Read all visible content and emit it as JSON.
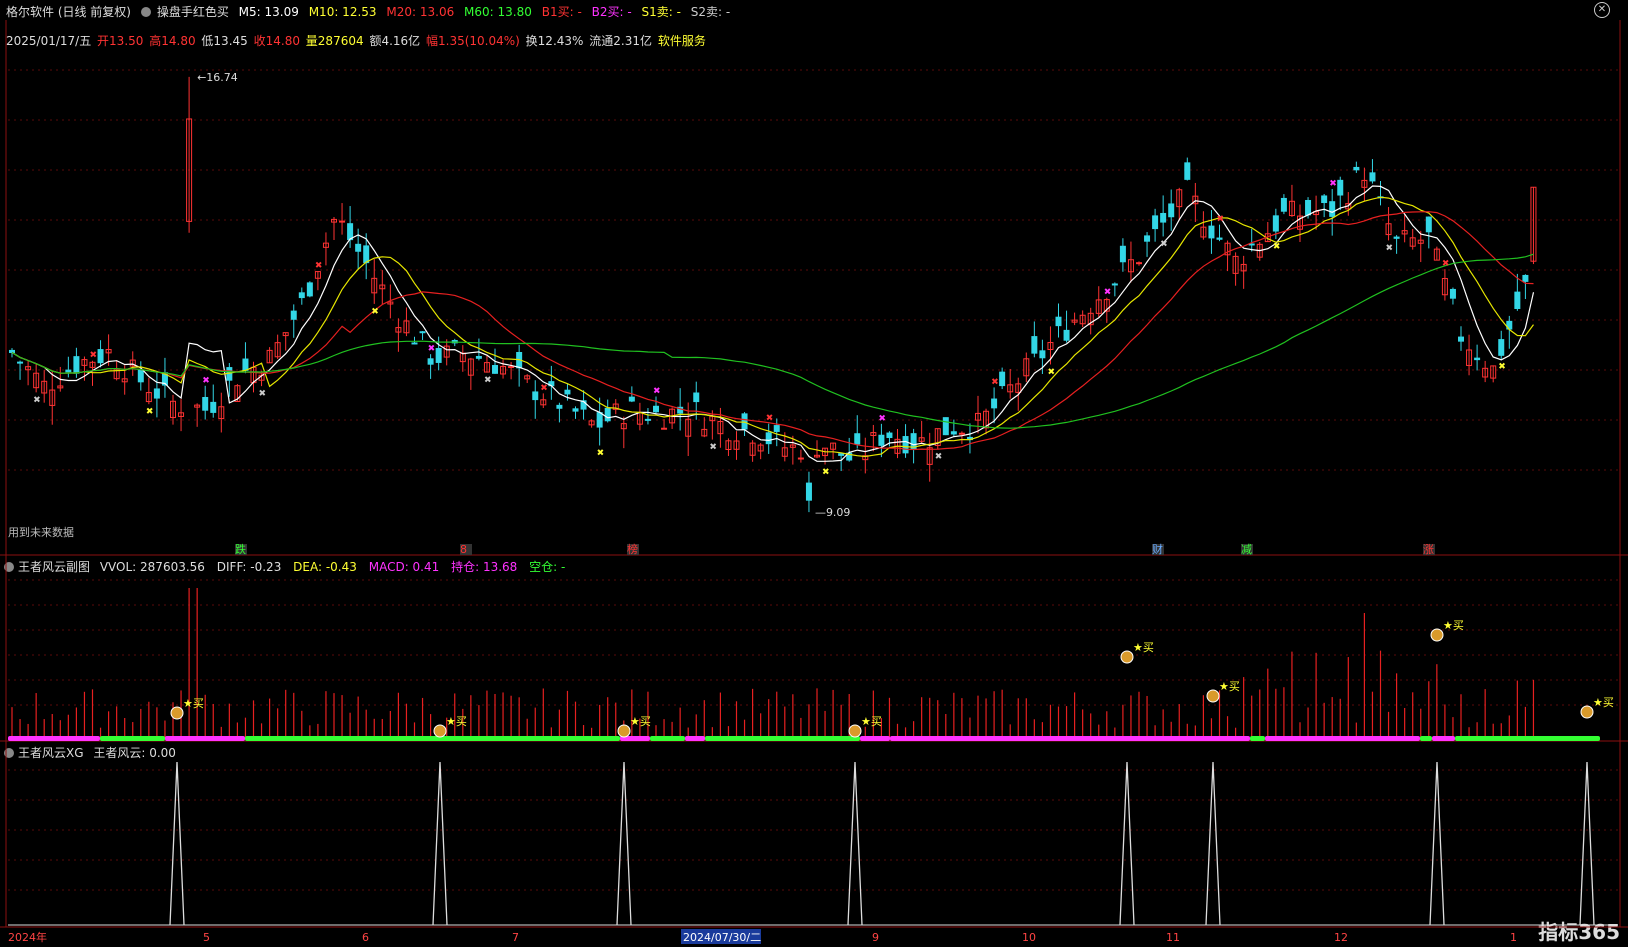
{
  "header": {
    "app_title": "格尔软件 (日线 前复权)",
    "indicator": "操盘手红色买",
    "m5": "M5: 13.09",
    "m10": "M10: 12.53",
    "m20": "M20: 13.06",
    "m60": "M60: 13.80",
    "b1": "B1买: -",
    "b2": "B2买: -",
    "s1": "S1卖: -",
    "s2": "S2卖: -"
  },
  "info": {
    "date": "2025/01/17/五",
    "open": "开13.50",
    "high": "高14.80",
    "low": "低13.45",
    "close": "收14.80",
    "volume": "量287604",
    "amount": "额4.16亿",
    "change": "幅1.35(10.04%)",
    "turnover": "换12.43%",
    "float": "流通2.31亿",
    "sector": "软件服务"
  },
  "main_chart": {
    "future_note": "用到未来数据",
    "high_label": "16.74",
    "low_label": "9.09",
    "events": [
      "跌",
      "8",
      "榜",
      "财",
      "减",
      "涨"
    ]
  },
  "sub1": {
    "title": "王者风云副图",
    "vvol": "VVOL: 287603.56",
    "diff": "DIFF: -0.23",
    "dea": "DEA: -0.43",
    "macd": "MACD: 0.41",
    "hold": "持仓: 13.68",
    "empty": "空仓: -",
    "buy_label": "★买"
  },
  "sub2": {
    "title": "王者风云XG",
    "value": "王者风云: 0.00"
  },
  "xaxis": {
    "labels": [
      "2024年",
      "5",
      "6",
      "7",
      "2024/07/30/二",
      "9",
      "10",
      "11",
      "12",
      "1"
    ]
  },
  "logo": "指标365",
  "colors": {
    "up": "#ff3333",
    "down": "#33d6e6",
    "m5": "#ffffff",
    "m10": "#e6e600",
    "m20": "#e62020",
    "m60": "#20c020",
    "magenta": "#ff33ff",
    "green": "#33ff33"
  },
  "chart_data": {
    "type": "candlestick",
    "ylim": [
      8.6,
      17.3
    ],
    "high": 16.74,
    "low": 9.09
  }
}
